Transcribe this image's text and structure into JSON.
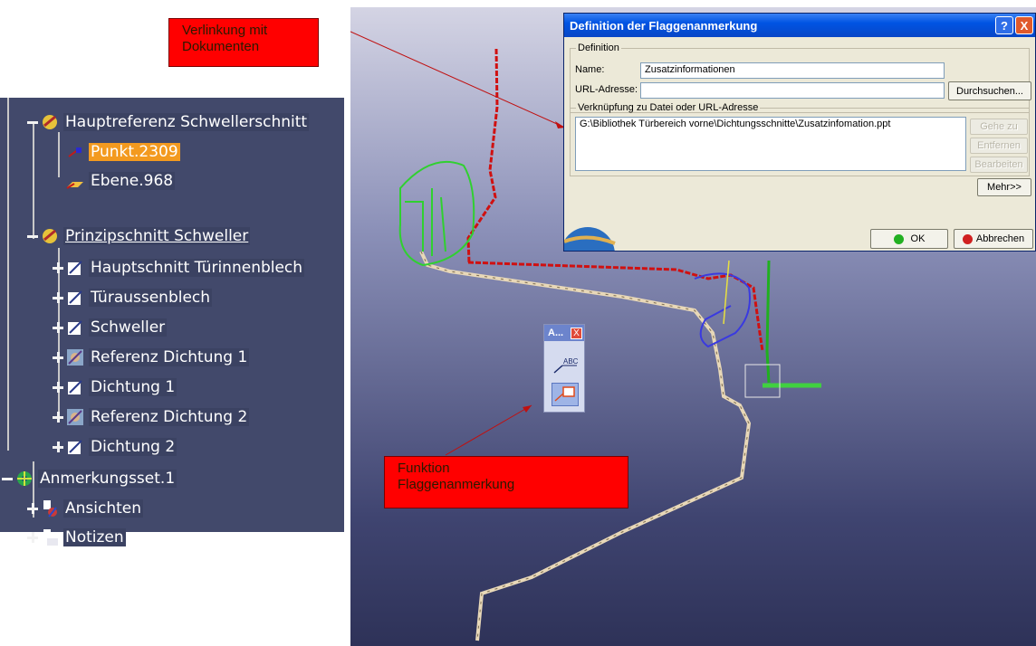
{
  "tree": {
    "items": [
      {
        "label": "Hauptreferenz Schwellerschnitt",
        "icon": "reference-icon"
      },
      {
        "label": "Punkt.2309",
        "icon": "point-icon",
        "selected": true
      },
      {
        "label": "Ebene.968",
        "icon": "plane-icon"
      },
      {
        "label": "Prinzipschnitt Schweller",
        "icon": "reference-icon",
        "underline": true
      },
      {
        "label": "Hauptschnitt Türinnenblech",
        "icon": "sketch-icon"
      },
      {
        "label": "Türaussenblech",
        "icon": "sketch-icon"
      },
      {
        "label": "Schweller",
        "icon": "sketch-icon"
      },
      {
        "label": "Referenz Dichtung 1",
        "icon": "reference-picture-icon"
      },
      {
        "label": "Dichtung 1",
        "icon": "sketch-icon"
      },
      {
        "label": "Referenz Dichtung 2",
        "icon": "reference-picture-icon"
      },
      {
        "label": "Dichtung 2",
        "icon": "sketch-icon"
      },
      {
        "label": "Anmerkungsset.1",
        "icon": "annotation-set-icon"
      },
      {
        "label": "Ansichten",
        "icon": "views-icon"
      },
      {
        "label": "Notizen",
        "icon": "notes-icon"
      }
    ]
  },
  "dialog": {
    "title": "Definition der Flaggenanmerkung",
    "help_label": "?",
    "close_label": "X",
    "definition_group": "Definition",
    "name_label": "Name:",
    "name_value": "Zusatzinformationen",
    "url_label": "URL-Adresse:",
    "url_value": "",
    "browse_button": "Durchsuchen...",
    "link_group": "Verknüpfung zu Datei oder URL-Adresse",
    "link_entry": "G:\\Bibliothek Türbereich vorne\\Dichtungsschnitte\\Zusatzinfomation.ppt",
    "goto_button": "Gehe zu",
    "remove_button": "Entfernen",
    "edit_button": "Bearbeiten",
    "more_button": "Mehr>>",
    "ok_button": "OK",
    "cancel_button": "Abbrechen"
  },
  "callouts": {
    "linking": "Verlinkung mit\nDokumenten",
    "function": "Funktion\nFlaggenanmerkung"
  },
  "mini_toolbar": {
    "title": "A...",
    "close_label": "X",
    "text_icon_label": "ABC"
  },
  "colors": {
    "tree_bg": "#42496b",
    "selected": "#f39a1f",
    "callout": "#ff0000",
    "dialog_title": "#0054e3"
  }
}
